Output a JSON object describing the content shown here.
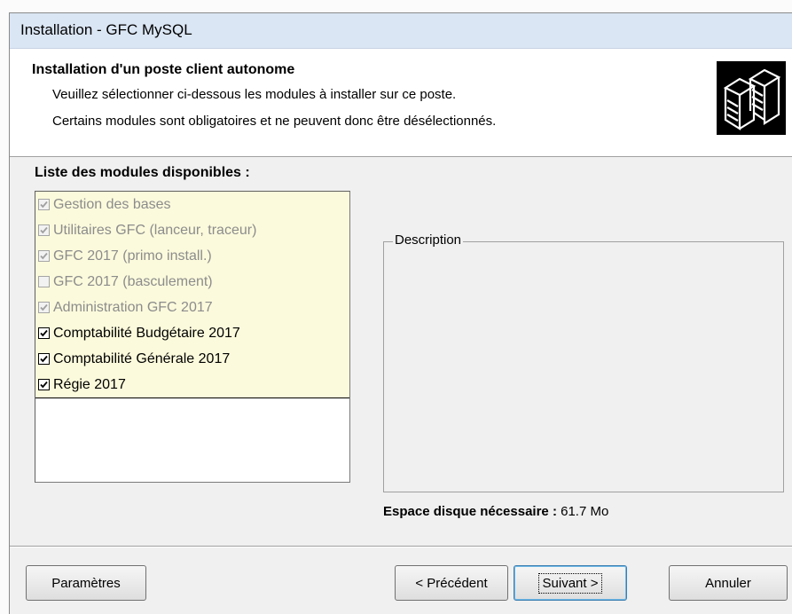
{
  "window": {
    "title": "Installation - GFC MySQL"
  },
  "header": {
    "title": "Installation d'un poste client autonome",
    "line1": "Veuillez sélectionner ci-dessous les modules à installer sur ce poste.",
    "line2": "Certains modules sont obligatoires et ne peuvent donc être désélectionnés.",
    "icon": "server-icon"
  },
  "modules": {
    "heading": "Liste des modules disponibles :",
    "items": [
      {
        "label": "Gestion des bases",
        "checked": true,
        "enabled": false
      },
      {
        "label": "Utilitaires GFC (lanceur, traceur)",
        "checked": true,
        "enabled": false
      },
      {
        "label": "GFC 2017 (primo install.)",
        "checked": true,
        "enabled": false
      },
      {
        "label": "GFC 2017 (basculement)",
        "checked": false,
        "enabled": false
      },
      {
        "label": "Administration GFC 2017",
        "checked": true,
        "enabled": false
      },
      {
        "label": "Comptabilité Budgétaire 2017",
        "checked": true,
        "enabled": true
      },
      {
        "label": "Comptabilité Générale 2017",
        "checked": true,
        "enabled": true
      },
      {
        "label": "Régie 2017",
        "checked": true,
        "enabled": true
      }
    ]
  },
  "description": {
    "label": "Description"
  },
  "disk": {
    "label": "Espace disque nécessaire :",
    "value": "61.7 Mo"
  },
  "buttons": {
    "parametres": "Paramètres",
    "precedent": "< Précédent",
    "suivant": "Suivant >",
    "annuler": "Annuler"
  },
  "colors": {
    "dialog_bg": "#f0f0f0",
    "titlebar_bg": "#dbe6f4",
    "list_highlight": "#fbfadc",
    "disabled_text": "#8c8c8c"
  }
}
